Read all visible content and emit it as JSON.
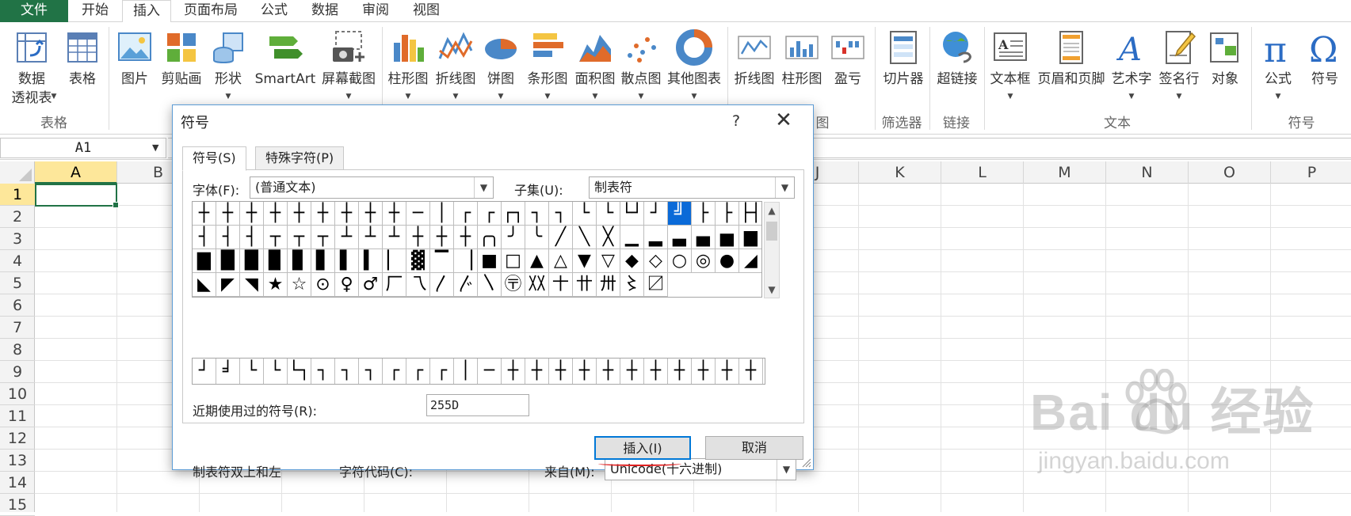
{
  "tabs": [
    "文件",
    "开始",
    "插入",
    "页面布局",
    "公式",
    "数据",
    "审阅",
    "视图"
  ],
  "active_tab": "插入",
  "ribbon": {
    "buttons": {
      "pivot_line1": "数据",
      "pivot_line2": "透视表",
      "table": "表格",
      "picture": "图片",
      "clipart": "剪贴画",
      "shapes": "形状",
      "smartart": "SmartArt",
      "screenshot": "屏幕截图",
      "column_chart": "柱形图",
      "line_chart": "折线图",
      "pie_chart": "饼图",
      "bar_chart": "条形图",
      "area_chart": "面积图",
      "scatter_chart": "散点图",
      "other_chart": "其他图表",
      "spark_line": "折线图",
      "spark_column": "柱形图",
      "spark_winloss": "盈亏",
      "slicer": "切片器",
      "hyperlink": "超链接",
      "textbox": "文本框",
      "header_footer": "页眉和页脚",
      "wordart": "艺术字",
      "signature": "签名行",
      "object": "对象",
      "equation": "公式",
      "symbol": "符号"
    },
    "groups": {
      "tables": "表格",
      "charts": "图",
      "filter": "筛选器",
      "links": "链接",
      "text": "文本",
      "symbols": "符号"
    }
  },
  "name_box": "A1",
  "columns": [
    "A",
    "B",
    "C",
    "D",
    "E",
    "F",
    "G",
    "H",
    "I",
    "J",
    "K",
    "L",
    "M",
    "N",
    "O",
    "P"
  ],
  "rows": [
    "1",
    "2",
    "3",
    "4",
    "5",
    "6",
    "7",
    "8",
    "9",
    "10",
    "11",
    "12",
    "13",
    "14",
    "15"
  ],
  "dialog": {
    "title": "符号",
    "help": "?",
    "close": "✕",
    "tab_symbols": "符号(S)",
    "tab_special": "特殊字符(P)",
    "font_label": "字体(F):",
    "font_value": "(普通文本)",
    "subset_label": "子集(U):",
    "subset_value": "制表符",
    "symbols": [
      "┼",
      "┼",
      "┼",
      "┼",
      "┼",
      "┼",
      "┼",
      "┼",
      "┼",
      "─",
      "│",
      "┌",
      "┌",
      "┌┐",
      "┐",
      "┐",
      "└",
      "└",
      "└┘",
      "┘",
      "╝",
      "├",
      "├",
      "├┤",
      "┤",
      "┤",
      "┤",
      "┬",
      "┬",
      "┬",
      "┴",
      "┴",
      "┴",
      "┼",
      "┼",
      "┼",
      "╭╮",
      "╯",
      "╰",
      "╱",
      "╲",
      "╳",
      "▁",
      "▂",
      "▃",
      "▄",
      "▅",
      "▆",
      "▇",
      "█",
      "█",
      "▉",
      "▊",
      "▋",
      "▌",
      "▍",
      "▏",
      "▓",
      "▔",
      "▕",
      "■",
      "□",
      "▲",
      "△",
      "▼",
      "▽",
      "◆",
      "◇",
      "○",
      "◎",
      "●",
      "◢",
      "◣",
      "◤",
      "◥",
      "★",
      "☆",
      "⊙",
      "♀",
      "♂",
      "厂",
      "乁",
      "〳",
      "〴",
      "〵",
      "〶",
      "〷",
      "〸",
      "〹",
      "〺",
      "〻",
      "〼"
    ],
    "selected_index": 20,
    "recent_label": "近期使用过的符号(R):",
    "recent": [
      "┘",
      "╛",
      "└",
      "└",
      "└┐",
      "┐",
      "┐",
      "┐",
      "┌",
      "┌",
      "┌",
      "│",
      "─",
      "┼",
      "┼",
      "┼",
      "┼",
      "┼",
      "┼",
      "┼",
      "┼",
      "┼",
      "┼",
      "┼"
    ],
    "char_name": "制表符双上和左",
    "code_label": "字符代码(C):",
    "code_value": "255D",
    "from_label": "来自(M):",
    "from_value": "Unicode(十六进制)",
    "insert_button": "插入(I)",
    "cancel_button": "取消"
  },
  "watermark": {
    "brand": "Bai du 经验",
    "url": "jingyan.baidu.com"
  }
}
